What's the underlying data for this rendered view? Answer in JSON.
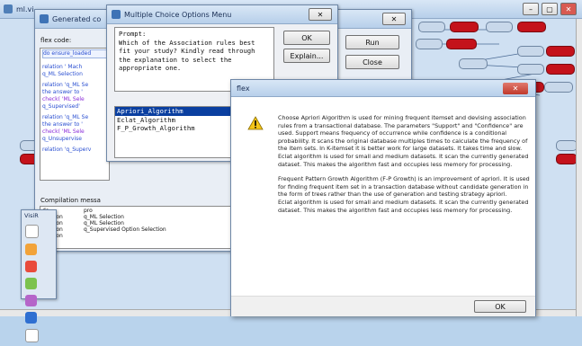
{
  "background_window": {
    "title": "ml.vi",
    "controls": [
      "–",
      "▢",
      "✕"
    ]
  },
  "generated_code_window": {
    "title": "Generated co",
    "code_label": "flex code:",
    "code_lines": [
      "do ensure_loaded",
      "relation   '  Mach",
      "   q_ML Selection",
      "relation 'q_ML Se",
      "  the answer to '",
      "  check( 'ML Sele",
      "  q_Supervised'",
      "relation 'q_ML Se",
      "  the answer to '",
      "  check( 'ML Sele",
      "  q_Unsupervise",
      "relation 'q_Superv"
    ],
    "run_label": "Run",
    "close_label": "Close",
    "compilation_label": "Compilation messa",
    "compilation_rows": [
      [
        "do",
        "pro"
      ],
      [
        "relation",
        "q_ML Selection"
      ],
      [
        "relation",
        "q_ML Selection"
      ],
      [
        "relation",
        "q_Supervised Option Selection"
      ],
      [
        "relation",
        ""
      ]
    ]
  },
  "mc_window": {
    "title": "Multiple Choice Options Menu",
    "prompt_label": "Prompt:",
    "prompt_text": "Which of the Association rules best fit your study? Kindly read through the explanation to select the appropriate one.",
    "ok_label": "OK",
    "explain_label": "Explain...",
    "options": [
      "Apriori_Algorithm",
      "Eclat_Algorithm",
      "F_P_Growth_Algorithm"
    ],
    "selected_index": 0
  },
  "flex_dialog": {
    "title": "flex",
    "message_1": "Choose Apriori Algorithm is used for mining frequent itemset and devising association rules from a transactional database. The parameters \"Support\" and \"Confidence\" are used. Support means frequency of occurrence while confidence is a conditional probability. It scans the original database multiples times to calculate the frequency of the item sets. In K-itemset it is better work for large datasets. It takes time and slow.",
    "message_2": "Eclat algorithm is used for small and medium datasets. It scan the currently generated dataset. This makes the algorithm fast and occupies less memory for processing.",
    "message_3": "Frequent Pattern Growth Algorithm (F-P Growth) is an improvement of apriori. It is used for finding frequent item set in a transaction database without candidate generation in the form of trees rather than the use of generation and testing strategy apriori.",
    "message_4": "Eclat algorithm is used for small and medium datasets. It scan the currently generated dataset. This makes the algorithm fast and occupies less memory for processing.",
    "ok_label": "OK",
    "close_icon": "✕"
  },
  "toolbox": {
    "title": "VisiR"
  },
  "colors": {
    "accent": "#2a5fa8",
    "node_red": "#c4121b",
    "selection": "#0a3fa0"
  }
}
